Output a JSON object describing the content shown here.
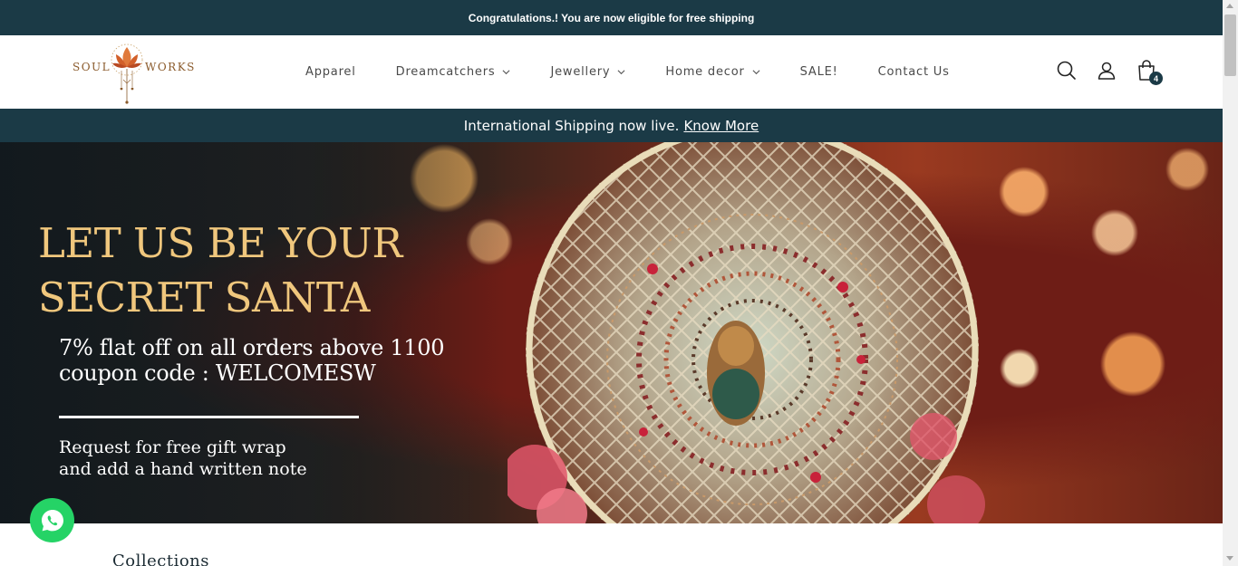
{
  "announcement": {
    "text": "Congratulations.! You are now eligible for free shipping"
  },
  "header": {
    "logo": {
      "left_text": "SOUL",
      "right_text": "WORKS",
      "icon": "lotus-logo-icon"
    },
    "nav": [
      {
        "label": "Apparel",
        "has_dropdown": false
      },
      {
        "label": "Dreamcatchers",
        "has_dropdown": true
      },
      {
        "label": "Jewellery",
        "has_dropdown": true
      },
      {
        "label": "Home decor",
        "has_dropdown": true
      },
      {
        "label": "SALE!",
        "has_dropdown": false
      },
      {
        "label": "Contact Us",
        "has_dropdown": false
      }
    ],
    "icons": {
      "search": "search-icon",
      "account": "account-icon",
      "cart": "cart-icon"
    },
    "cart_count": "4"
  },
  "shipping_bar": {
    "text": "International Shipping now live.",
    "link": "Know More"
  },
  "hero": {
    "title_line1": "LET US BE YOUR",
    "title_line2": "SECRET SANTA",
    "offer_line1": "7% flat off on all orders above 1100",
    "offer_line2": "coupon code : WELCOMESW",
    "gift_line1": "Request for free gift wrap",
    "gift_line2": "and add a hand written note"
  },
  "floating": {
    "whatsapp_icon": "whatsapp-icon"
  },
  "sections": {
    "collections_heading": "Collections"
  },
  "colors": {
    "brand_dark": "#1b3a46",
    "hero_title": "#f0c77d",
    "logo_brown": "#8a5a2b",
    "whatsapp": "#25d366"
  }
}
